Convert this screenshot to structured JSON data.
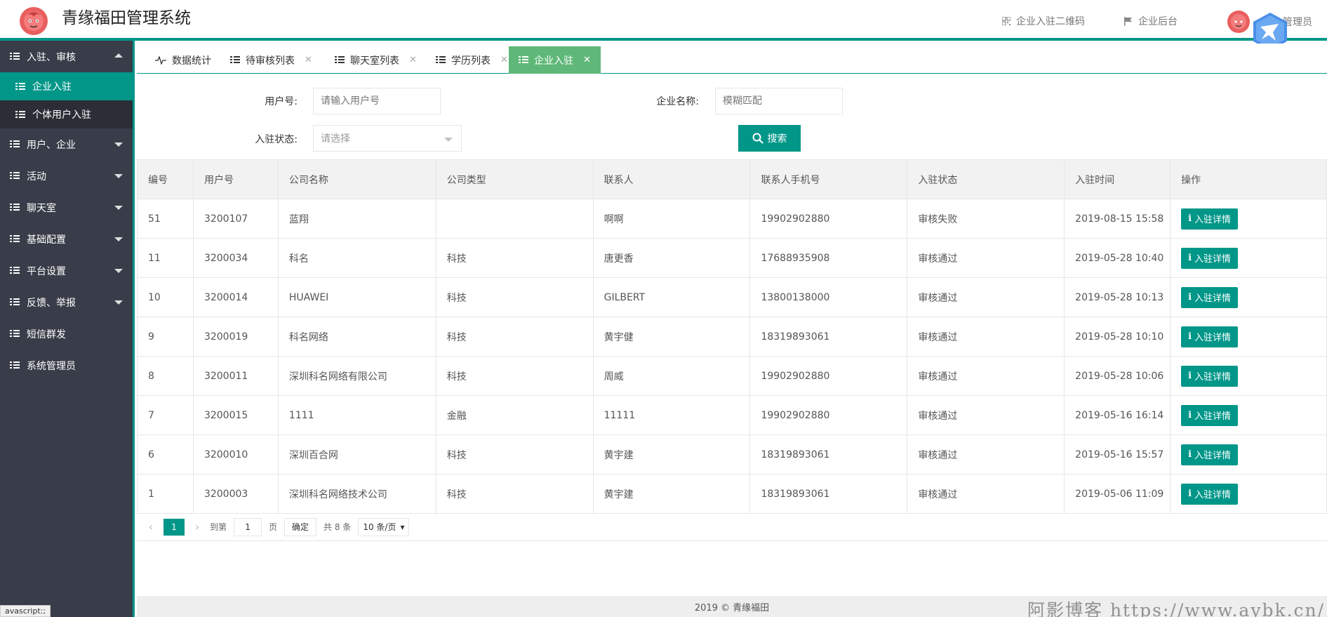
{
  "header": {
    "app_title": "青缘福田管理系统",
    "qr_link": "企业入驻二维码",
    "admin_link": "企业后台",
    "user_name": "管理员"
  },
  "sidebar": {
    "items": [
      {
        "label": "入驻、审核",
        "expanded": true,
        "children": [
          {
            "label": "企业入驻",
            "active": true
          },
          {
            "label": "个体用户入驻",
            "active": false
          }
        ]
      },
      {
        "label": "用户、企业",
        "has_children": true
      },
      {
        "label": "活动",
        "has_children": true
      },
      {
        "label": "聊天室",
        "has_children": true
      },
      {
        "label": "基础配置",
        "has_children": true
      },
      {
        "label": "平台设置",
        "has_children": true
      },
      {
        "label": "反馈、举报",
        "has_children": true
      },
      {
        "label": "短信群发",
        "has_children": false
      },
      {
        "label": "系统管理员",
        "has_children": false
      }
    ]
  },
  "tabs": [
    {
      "label": "数据统计",
      "closable": false,
      "icon": "pulse-icon"
    },
    {
      "label": "待审核列表",
      "closable": true,
      "icon": "list-icon"
    },
    {
      "label": "聊天室列表",
      "closable": true,
      "icon": "list-icon"
    },
    {
      "label": "学历列表",
      "closable": true,
      "icon": "list-icon"
    },
    {
      "label": "企业入驻",
      "closable": true,
      "icon": "list-icon",
      "active": true
    }
  ],
  "search": {
    "user_label": "用户号:",
    "user_placeholder": "请输入用户号",
    "company_label": "企业名称:",
    "company_placeholder": "模糊匹配",
    "status_label": "入驻状态:",
    "status_placeholder": "请选择",
    "button_label": "搜索"
  },
  "table": {
    "columns": [
      "编号",
      "用户号",
      "公司名称",
      "公司类型",
      "联系人",
      "联系人手机号",
      "入驻状态",
      "入驻时间",
      "操作"
    ],
    "action_label": "入驻详情",
    "rows": [
      [
        "51",
        "3200107",
        "蓝翔",
        "",
        "啊啊",
        "19902902880",
        "审核失败",
        "2019-08-15 15:58"
      ],
      [
        "11",
        "3200034",
        "科名",
        "科技",
        "唐更香",
        "17688935908",
        "审核通过",
        "2019-05-28 10:40"
      ],
      [
        "10",
        "3200014",
        "HUAWEI",
        "科技",
        "GILBERT",
        "13800138000",
        "审核通过",
        "2019-05-28 10:13"
      ],
      [
        "9",
        "3200019",
        "科名网络",
        "科技",
        "黄宇健",
        "18319893061",
        "审核通过",
        "2019-05-28 10:10"
      ],
      [
        "8",
        "3200011",
        "深圳科名网络有限公司",
        "科技",
        "周威",
        "19902902880",
        "审核通过",
        "2019-05-28 10:06"
      ],
      [
        "7",
        "3200015",
        "1111",
        "金融",
        "11111",
        "19902902880",
        "审核通过",
        "2019-05-16 16:14"
      ],
      [
        "6",
        "3200010",
        "深圳百合网",
        "科技",
        "黄宇建",
        "18319893061",
        "审核通过",
        "2019-05-16 15:57"
      ],
      [
        "1",
        "3200003",
        "深圳科名网络技术公司",
        "科技",
        "黄宇建",
        "18319893061",
        "审核通过",
        "2019-05-06 11:09"
      ]
    ]
  },
  "pager": {
    "current_page": "1",
    "goto_label": "到第",
    "goto_value": "1",
    "page_unit": "页",
    "confirm_label": "确定",
    "total_label": "共 8 条",
    "page_size": "10 条/页"
  },
  "footer": {
    "copyright": "2019 © 青缘福田"
  },
  "watermark": "阿影博客 https://www.aybk.cn/",
  "status_tip": "avascript:;",
  "colors": {
    "primary": "#009688",
    "sidebar_bg": "#393d49",
    "active_tab": "#5fb878"
  }
}
